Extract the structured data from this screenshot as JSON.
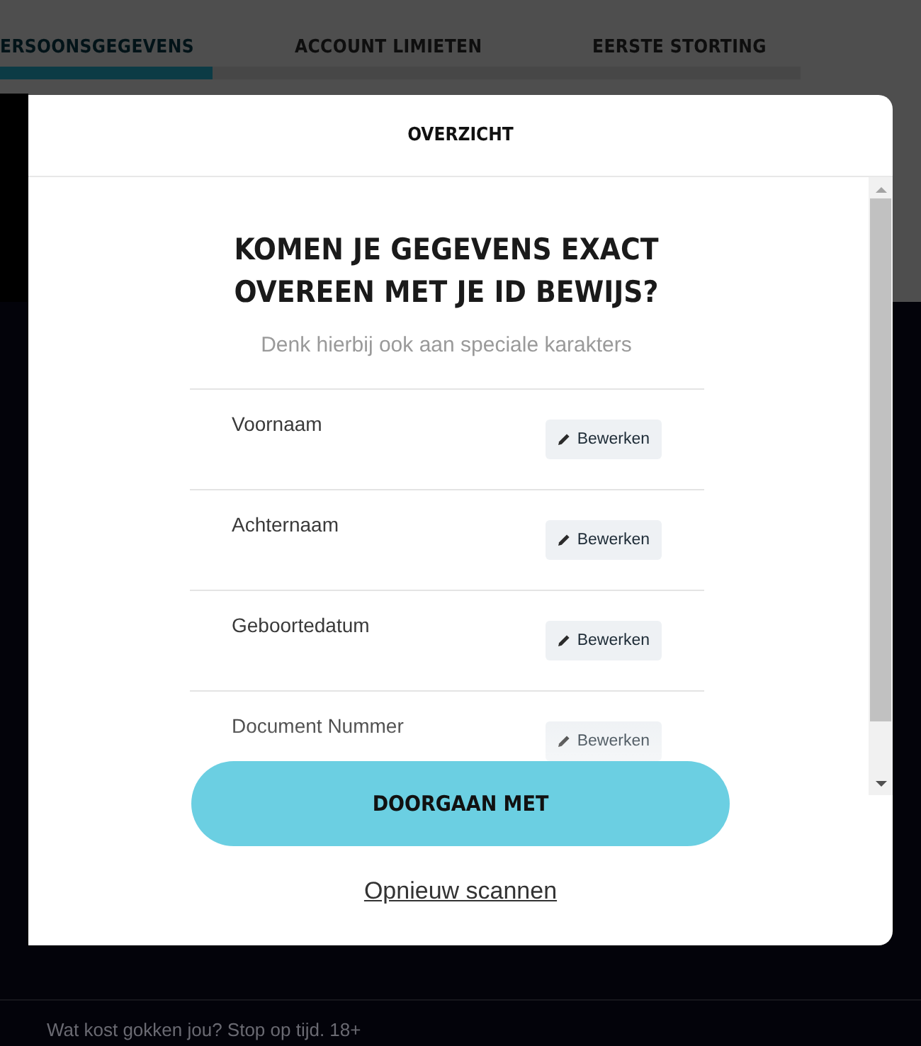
{
  "steps": [
    {
      "label": "ERSOONSGEGEVENS",
      "selected": true
    },
    {
      "label": "ACCOUNT LIMIETEN",
      "selected": false
    },
    {
      "label": "EERSTE STORTING",
      "selected": false
    }
  ],
  "modal": {
    "title": "OVERZICHT",
    "heading": "KOMEN JE GEGEVENS EXACT OVEREEN MET JE ID BEWIJS?",
    "subtitle": "Denk hierbij ook aan speciale karakters",
    "fields": [
      {
        "label": "Voornaam",
        "action": "Bewerken"
      },
      {
        "label": "Achternaam",
        "action": "Bewerken"
      },
      {
        "label": "Geboortedatum",
        "action": "Bewerken"
      },
      {
        "label": "Document Nummer",
        "action": "Bewerken"
      }
    ],
    "primary_button": "DOORGAAN MET",
    "link": "Opnieuw scannen"
  },
  "footer": {
    "text": "Wat kost gokken jou? Stop op tijd. 18+"
  }
}
